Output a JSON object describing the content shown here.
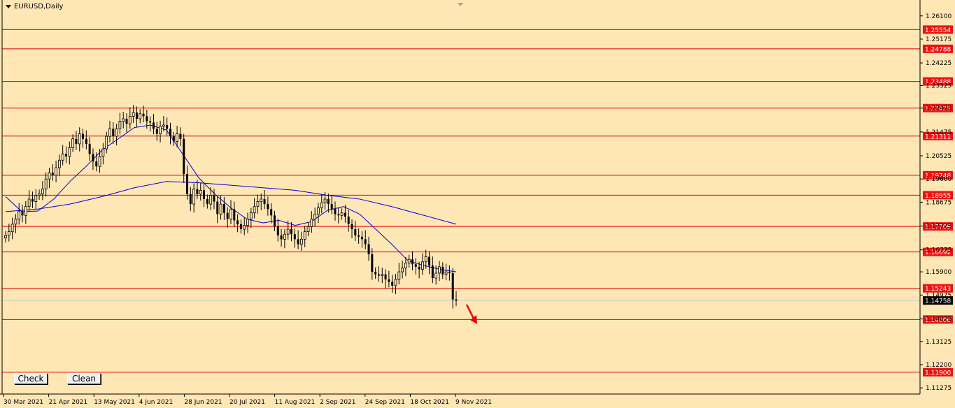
{
  "symbol": "EURUSD,Daily",
  "buttons": {
    "check": "Check",
    "clean": "Clean"
  },
  "colors": {
    "background": "#ffe6b5",
    "candle": "#000000",
    "level_line": "#dd0000",
    "level_label_bg": "#ee1111",
    "ma": "#0000dd",
    "current_price_bg": "#000000",
    "arrow": "#ee0000"
  },
  "chart_data": {
    "type": "candlestick",
    "title": "",
    "x_ticks": [
      "30 Mar 2021",
      "21 Apr 2021",
      "13 May 2021",
      "4 Jun 2021",
      "28 Jun 2021",
      "20 Jul 2021",
      "11 Aug 2021",
      "2 Sep 2021",
      "24 Sep 2021",
      "18 Oct 2021",
      "9 Nov 2021"
    ],
    "y_ticks": [
      "1.26100",
      "1.25175",
      "1.24225",
      "1.23325",
      "1.22425",
      "1.21475",
      "1.20525",
      "1.19600",
      "1.18675",
      "1.17725",
      "1.16775",
      "1.15900",
      "1.14975",
      "1.14025",
      "1.13125",
      "1.12200",
      "1.11275"
    ],
    "y_range": [
      1.1103,
      1.2665
    ],
    "levels": [
      "1.25554",
      "1.24788",
      "1.23488",
      "1.22425",
      "1.21311",
      "1.19748",
      "1.18955",
      "1.17709",
      "1.16692",
      "1.15243",
      "1.14000",
      "1.11900"
    ],
    "current_price": "1.14758",
    "moving_averages": [
      {
        "period_note": "fast",
        "points": [
          [
            0,
            1.189
          ],
          [
            10,
            1.183
          ],
          [
            20,
            1.1832
          ],
          [
            30,
            1.188
          ],
          [
            40,
            1.195
          ],
          [
            50,
            1.201
          ],
          [
            60,
            1.2075
          ],
          [
            70,
            1.212
          ],
          [
            80,
            1.2165
          ],
          [
            90,
            1.2175
          ],
          [
            100,
            1.2155
          ],
          [
            110,
            1.206
          ],
          [
            120,
            1.1965
          ],
          [
            130,
            1.19
          ],
          [
            140,
            1.1845
          ],
          [
            150,
            1.18
          ],
          [
            160,
            1.1785
          ],
          [
            170,
            1.1795
          ],
          [
            180,
            1.1775
          ],
          [
            190,
            1.179
          ],
          [
            200,
            1.1835
          ],
          [
            210,
            1.185
          ],
          [
            220,
            1.182
          ],
          [
            230,
            1.176
          ],
          [
            240,
            1.17
          ],
          [
            250,
            1.1635
          ],
          [
            260,
            1.1615
          ],
          [
            270,
            1.16
          ],
          [
            280,
            1.159
          ]
        ]
      },
      {
        "period_note": "slow",
        "points": [
          [
            0,
            1.183
          ],
          [
            20,
            1.184
          ],
          [
            40,
            1.186
          ],
          [
            60,
            1.189
          ],
          [
            80,
            1.1925
          ],
          [
            100,
            1.195
          ],
          [
            120,
            1.1945
          ],
          [
            140,
            1.1935
          ],
          [
            160,
            1.1925
          ],
          [
            180,
            1.1915
          ],
          [
            200,
            1.1895
          ],
          [
            220,
            1.188
          ],
          [
            240,
            1.185
          ],
          [
            260,
            1.1815
          ],
          [
            280,
            1.178
          ]
        ]
      }
    ],
    "closes": [
      1.1735,
      1.175,
      1.178,
      1.18,
      1.183,
      1.1815,
      1.185,
      1.188,
      1.187,
      1.1895,
      1.19,
      1.192,
      1.196,
      1.1985,
      1.1975,
      1.2005,
      1.2035,
      1.206,
      1.205,
      1.2085,
      1.212,
      1.21,
      1.214,
      1.212,
      1.21,
      1.206,
      1.203,
      1.201,
      1.205,
      1.208,
      1.213,
      1.216,
      1.213,
      1.216,
      1.219,
      1.22,
      1.218,
      1.221,
      1.2225,
      1.22,
      1.222,
      1.221,
      1.219,
      1.2185,
      1.216,
      1.214,
      1.217,
      1.2175,
      1.216,
      1.213,
      1.211,
      1.214,
      1.212,
      1.198,
      1.19,
      1.186,
      1.192,
      1.19,
      1.1915,
      1.188,
      1.186,
      1.1895,
      1.187,
      1.182,
      1.186,
      1.1825,
      1.18,
      1.184,
      1.1795,
      1.178,
      1.176,
      1.1775,
      1.18,
      1.1825,
      1.185,
      1.187,
      1.188,
      1.186,
      1.184,
      1.1815,
      1.177,
      1.1735,
      1.172,
      1.174,
      1.176,
      1.174,
      1.172,
      1.17,
      1.172,
      1.175,
      1.177,
      1.18,
      1.182,
      1.1845,
      1.1865,
      1.188,
      1.186,
      1.184,
      1.182,
      1.1815,
      1.1825,
      1.181,
      1.178,
      1.176,
      1.1735,
      1.173,
      1.172,
      1.17,
      1.166,
      1.159,
      1.158,
      1.1575,
      1.158,
      1.156,
      1.155,
      1.1535,
      1.156,
      1.159,
      1.1605,
      1.1625,
      1.164,
      1.162,
      1.161,
      1.16,
      1.163,
      1.165,
      1.1615,
      1.1565,
      1.1585,
      1.161,
      1.158,
      1.159,
      1.1585,
      1.148,
      1.1475
    ]
  }
}
